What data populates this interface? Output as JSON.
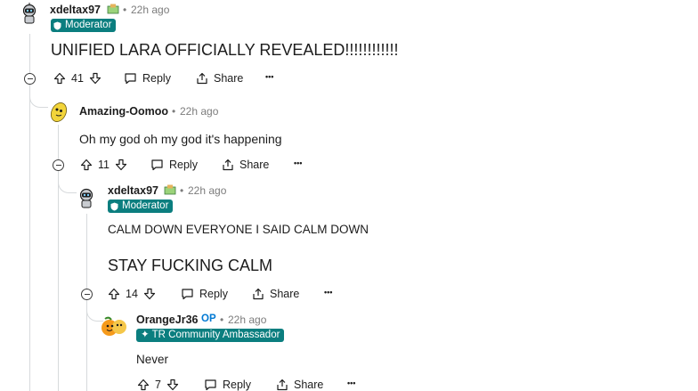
{
  "comments": [
    {
      "author": "xdeltax97",
      "time": "22h ago",
      "flair": "Moderator",
      "body": [
        "UNIFIED LARA OFFICIALLY REVEALED!!!!!!!!!!!!"
      ],
      "votes": "41",
      "reply_label": "Reply",
      "share_label": "Share"
    },
    {
      "author": "Amazing-Oomoo",
      "time": "22h ago",
      "body": [
        "Oh my god oh my god it's happening"
      ],
      "votes": "11",
      "reply_label": "Reply",
      "share_label": "Share"
    },
    {
      "author": "xdeltax97",
      "time": "22h ago",
      "flair": "Moderator",
      "body": [
        "CALM DOWN EVERYONE I SAID CALM DOWN",
        "STAY FUCKING CALM"
      ],
      "votes": "14",
      "reply_label": "Reply",
      "share_label": "Share"
    },
    {
      "author": "OrangeJr36",
      "op_label": "OP",
      "time": "22h ago",
      "flair": "✦ TR Community Ambassador",
      "body": [
        "Never"
      ],
      "votes": "7",
      "reply_label": "Reply",
      "share_label": "Share"
    }
  ],
  "separator": "•",
  "more_label": "•••",
  "colors": {
    "flair_bg": "#0b7e7f",
    "op": "#0079d3",
    "thread_line": "#d7dadc"
  }
}
